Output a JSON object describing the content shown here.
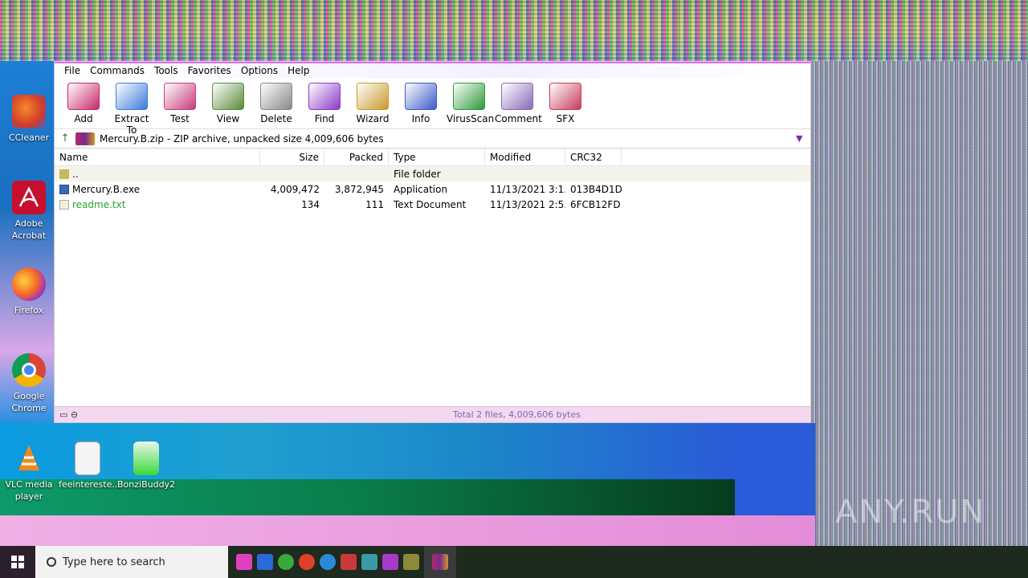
{
  "window": {
    "menu": [
      "File",
      "Commands",
      "Tools",
      "Favorites",
      "Options",
      "Help"
    ],
    "toolbar": [
      {
        "label": "Add",
        "icon": "add-icon",
        "color": "#c8286a"
      },
      {
        "label": "Extract To",
        "icon": "extract-to-icon",
        "color": "#3a7ad8"
      },
      {
        "label": "Test",
        "icon": "test-icon",
        "color": "#c83a7a"
      },
      {
        "label": "View",
        "icon": "view-icon",
        "color": "#5a8a3a"
      },
      {
        "label": "Delete",
        "icon": "delete-icon",
        "color": "#888888"
      },
      {
        "label": "Find",
        "icon": "find-icon",
        "color": "#8a3ac8"
      },
      {
        "label": "Wizard",
        "icon": "wizard-icon",
        "color": "#c89a2a"
      },
      {
        "label": "Info",
        "icon": "info-icon",
        "color": "#3a5ac8"
      },
      {
        "label": "VirusScan",
        "icon": "virusscan-icon",
        "color": "#2a9a3a"
      },
      {
        "label": "Comment",
        "icon": "comment-icon",
        "color": "#8a6ab8"
      },
      {
        "label": "SFX",
        "icon": "sfx-icon",
        "color": "#c83a5a"
      }
    ],
    "path": "Mercury.B.zip - ZIP archive, unpacked size 4,009,606 bytes",
    "columns": {
      "name": "Name",
      "size": "Size",
      "packed": "Packed",
      "type": "Type",
      "modified": "Modified",
      "crc": "CRC32"
    },
    "rows": [
      {
        "name": "..",
        "size": "",
        "packed": "",
        "type": "File folder",
        "modified": "",
        "crc": ""
      },
      {
        "name": "Mercury.B.exe",
        "size": "4,009,472",
        "packed": "3,872,945",
        "type": "Application",
        "modified": "11/13/2021 3:1...",
        "crc": "013B4D1D"
      },
      {
        "name": "readme.txt",
        "size": "134",
        "packed": "111",
        "type": "Text Document",
        "modified": "11/13/2021 2:5...",
        "crc": "6FCB12FD"
      }
    ],
    "status": "Total 2 files, 4,009,606 bytes"
  },
  "desktop": {
    "icons": [
      {
        "label": "CCleaner",
        "icon": "ccleaner-icon"
      },
      {
        "label": "Adobe Acrobat",
        "icon": "acrobat-icon"
      },
      {
        "label": "Firefox",
        "icon": "firefox-icon"
      },
      {
        "label": "Google Chrome",
        "icon": "chrome-icon"
      },
      {
        "label": "VLC media player",
        "icon": "vlc-icon"
      },
      {
        "label": "feeintereste...",
        "icon": "document-icon"
      },
      {
        "label": "BonziBuddy2",
        "icon": "bonzi-icon"
      }
    ]
  },
  "taskbar": {
    "search_placeholder": "Type here to search"
  },
  "watermark": "ANY.RUN"
}
